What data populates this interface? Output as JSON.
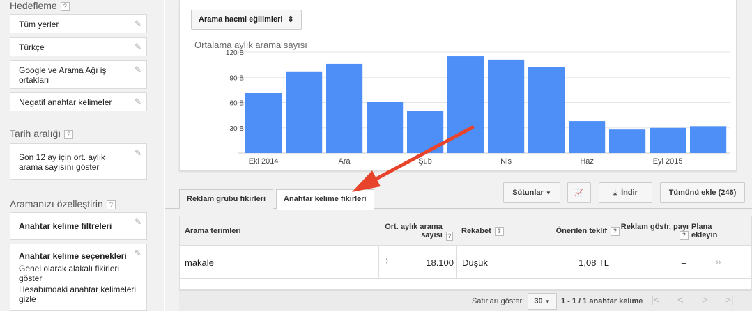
{
  "sidebar": {
    "targeting_title": "Hedefleme",
    "help": "?",
    "targeting_items": [
      "Tüm yerler",
      "Türkçe",
      "Google ve Arama Ağı iş ortakları",
      "Negatif anahtar kelimeler"
    ],
    "date_title": "Tarih aralığı",
    "date_card": "Son 12 ay için ort. aylık arama sayısını göster",
    "customize_title": "Aramanızı özelleştirin",
    "filters_label": "Anahtar kelime filtreleri",
    "options_label": "Anahtar kelime seçenekleri",
    "options_line1": "Genel olarak alakalı fikirleri göster",
    "options_line2": "Hesabımdaki anahtar kelimeleri gizle"
  },
  "chart_header": {
    "dropdown": "Arama hacmi eğilimleri"
  },
  "chart_data": {
    "type": "bar",
    "title": "Ortalama aylık arama sayısı",
    "y_ticks": [
      "30 B",
      "60 B",
      "90 B",
      "120 B"
    ],
    "x_ticks": [
      "Eki 2014",
      "Ara",
      "Şub",
      "Nis",
      "Haz",
      "Eyl 2015"
    ],
    "ylim": [
      0,
      120
    ],
    "values": [
      72,
      97,
      106,
      61,
      50,
      115,
      111,
      102,
      38,
      28,
      30,
      32
    ],
    "grid": true,
    "bar_color": "#4d8ff7"
  },
  "tabs": [
    "Reklam grubu fikirleri",
    "Anahtar kelime fikirleri"
  ],
  "toolbar": {
    "columns": "Sütunlar",
    "download": "İndir",
    "add_all": "Tümünü ekle (246)"
  },
  "table": {
    "headers": {
      "term": "Arama terimleri",
      "avg": "Ort. aylık arama sayısı",
      "comp": "Rekabet",
      "bid": "Önerilen teklif",
      "share": "Reklam göstr. payı",
      "plan": "Plana ekleyin"
    },
    "rows": [
      {
        "term": "makale",
        "avg": "18.100",
        "comp": "Düşük",
        "bid": "1,08 TL",
        "share": "–",
        "add": "»"
      }
    ]
  },
  "footer": {
    "rows_label": "Satırları göster:",
    "rows_value": "30",
    "range": "1 - 1 / 1 anahtar kelime"
  }
}
